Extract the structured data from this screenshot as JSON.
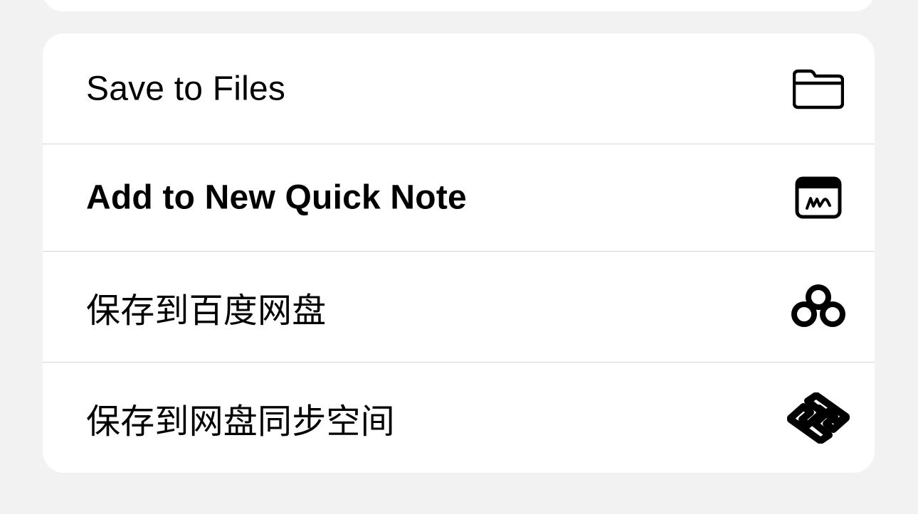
{
  "share_menu": {
    "items": [
      {
        "label": "Save to Files",
        "icon": "folder-icon",
        "bold": false
      },
      {
        "label": "Add to New Quick Note",
        "icon": "quick-note-icon",
        "bold": true
      },
      {
        "label": "保存到百度网盘",
        "icon": "baidu-netdisk-icon",
        "bold": false
      },
      {
        "label": "保存到网盘同步空间",
        "icon": "netdisk-sync-icon",
        "bold": false
      }
    ]
  },
  "colors": {
    "background": "#f2f2f2",
    "card": "#ffffff",
    "text": "#000000",
    "divider": "#d6d6d8"
  }
}
